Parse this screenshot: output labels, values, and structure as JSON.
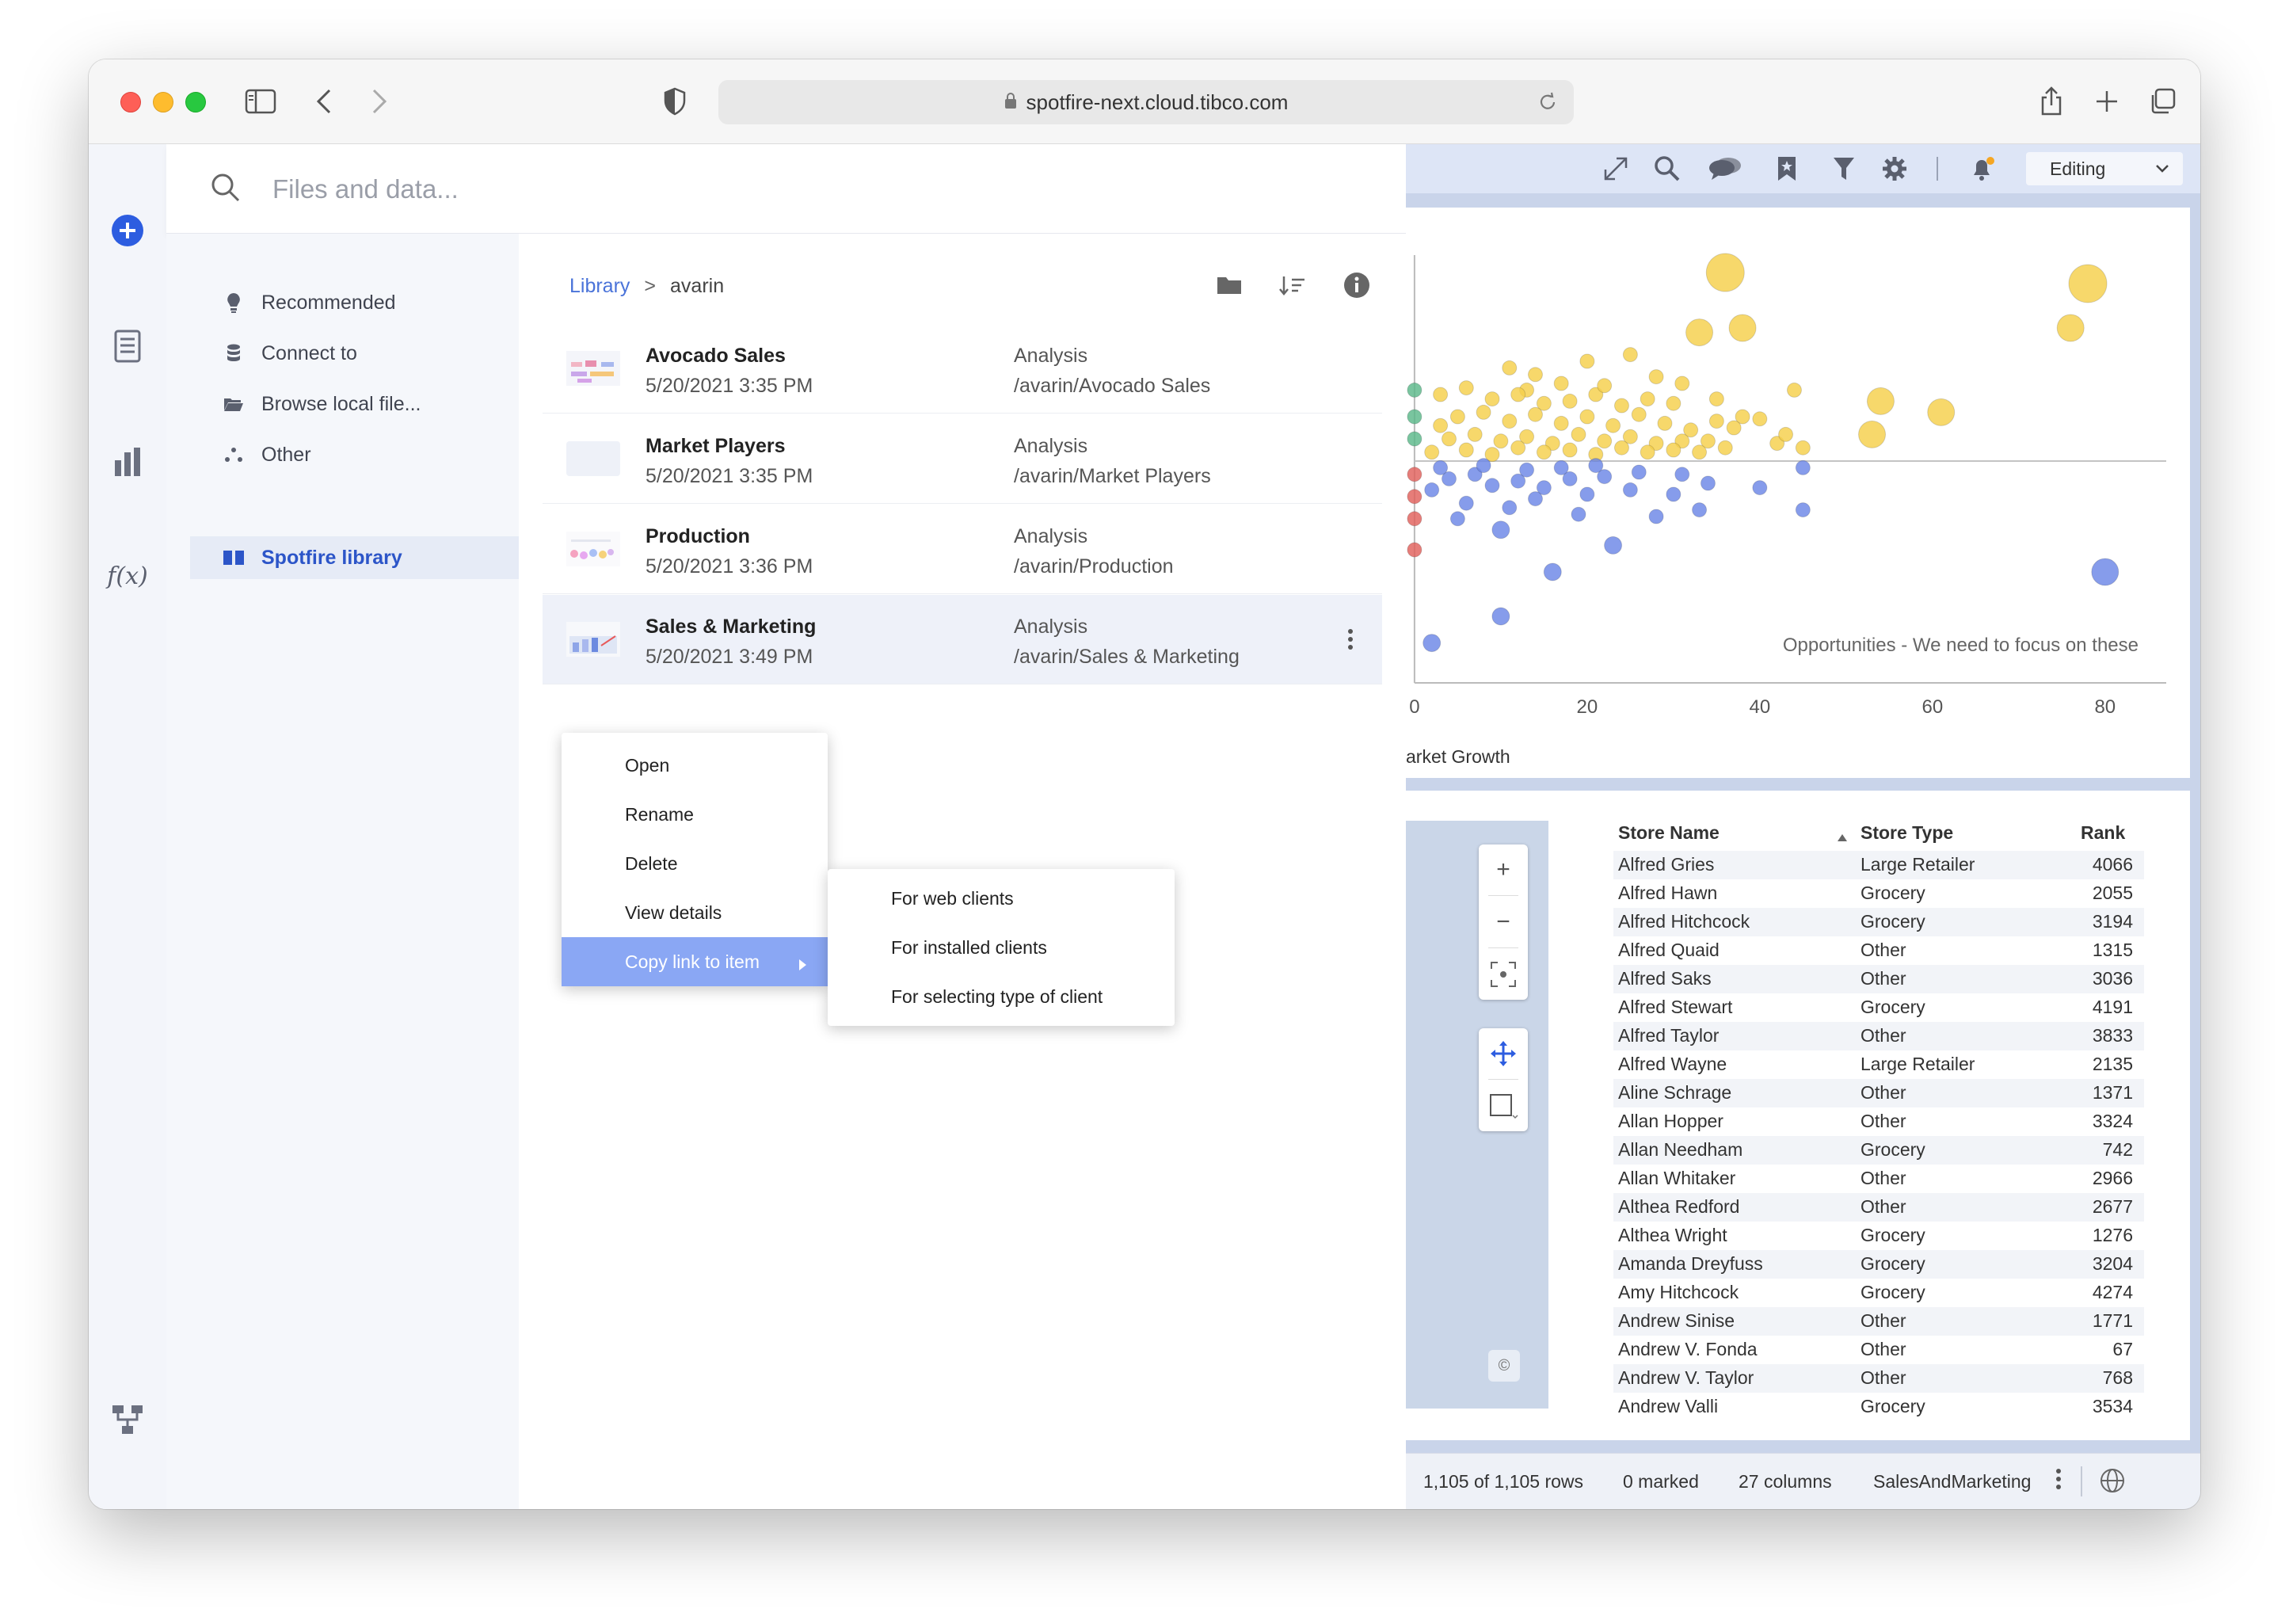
{
  "browser": {
    "url": "spotfire-next.cloud.tibco.com"
  },
  "search": {
    "placeholder": "Files and data..."
  },
  "nav": [
    {
      "label": "Recommended",
      "icon": "lightbulb-icon"
    },
    {
      "label": "Connect to",
      "icon": "database-icon"
    },
    {
      "label": "Browse local file...",
      "icon": "folder-icon"
    },
    {
      "label": "Other",
      "icon": "dots-icon"
    },
    {
      "label": "Spotfire library",
      "icon": "book-icon"
    }
  ],
  "breadcrumb": {
    "root": "Library",
    "separator": ">",
    "current": "avarin"
  },
  "files": [
    {
      "name": "Avocado Sales",
      "date": "5/20/2021 3:35 PM",
      "type": "Analysis",
      "path": "/avarin/Avocado Sales"
    },
    {
      "name": "Market Players",
      "date": "5/20/2021 3:35 PM",
      "type": "Analysis",
      "path": "/avarin/Market Players"
    },
    {
      "name": "Production",
      "date": "5/20/2021 3:36 PM",
      "type": "Analysis",
      "path": "/avarin/Production"
    },
    {
      "name": "Sales & Marketing",
      "date": "5/20/2021 3:49 PM",
      "type": "Analysis",
      "path": "/avarin/Sales & Marketing"
    }
  ],
  "context_menu": [
    "Open",
    "Rename",
    "Delete",
    "View details",
    "Copy link to item"
  ],
  "submenu": [
    "For web clients",
    "For installed clients",
    "For selecting type of client"
  ],
  "analysis": {
    "mode": "Editing",
    "annotation": "Opportunities - We need to focus on these",
    "x_axis_label": "arket Growth"
  },
  "chart_data": {
    "type": "scatter",
    "x_ticks": [
      "0",
      "20",
      "40",
      "60",
      "80"
    ],
    "xlim": [
      -1,
      88
    ],
    "ylim": [
      -10,
      10
    ],
    "reference_y": 0,
    "series": [
      {
        "color": "#f5d04a",
        "points": [
          [
            36,
            8.5
          ],
          [
            78,
            8
          ],
          [
            33,
            5.8
          ],
          [
            38,
            6
          ],
          [
            76,
            6
          ],
          [
            20,
            4.5
          ],
          [
            25,
            4.8
          ],
          [
            11,
            4.2
          ],
          [
            17,
            3.5
          ],
          [
            13,
            3.2
          ],
          [
            28,
            3.8
          ],
          [
            31,
            3.5
          ],
          [
            44,
            3.2
          ],
          [
            54,
            2.7
          ],
          [
            61,
            2.2
          ],
          [
            38,
            2
          ],
          [
            53,
            1.2
          ],
          [
            42,
            0.8
          ],
          [
            45,
            0.6
          ],
          [
            37,
            1.5
          ],
          [
            35,
            1.8
          ],
          [
            40,
            1.9
          ],
          [
            43,
            1.2
          ],
          [
            3,
            3
          ],
          [
            6,
            3.3
          ],
          [
            9,
            2.8
          ],
          [
            12,
            3
          ],
          [
            15,
            2.6
          ],
          [
            18,
            2.7
          ],
          [
            21,
            3
          ],
          [
            24,
            2.5
          ],
          [
            27,
            2.8
          ],
          [
            30,
            2.6
          ],
          [
            5,
            2
          ],
          [
            8,
            2.2
          ],
          [
            11,
            1.8
          ],
          [
            14,
            2.1
          ],
          [
            17,
            1.7
          ],
          [
            20,
            2
          ],
          [
            23,
            1.6
          ],
          [
            26,
            2.1
          ],
          [
            29,
            1.7
          ],
          [
            32,
            1.4
          ],
          [
            4,
            1
          ],
          [
            7,
            1.2
          ],
          [
            10,
            0.9
          ],
          [
            13,
            1.1
          ],
          [
            16,
            0.8
          ],
          [
            19,
            1.2
          ],
          [
            22,
            0.9
          ],
          [
            25,
            1.1
          ],
          [
            28,
            0.8
          ],
          [
            31,
            0.9
          ],
          [
            34,
            0.9
          ],
          [
            2,
            0.4
          ],
          [
            6,
            0.5
          ],
          [
            9,
            0.3
          ],
          [
            12,
            0.6
          ],
          [
            15,
            0.4
          ],
          [
            18,
            0.5
          ],
          [
            21,
            0.3
          ],
          [
            24,
            0.6
          ],
          [
            27,
            0.4
          ],
          [
            30,
            0.5
          ],
          [
            33,
            0.4
          ],
          [
            36,
            0.6
          ],
          [
            3,
            1.6
          ],
          [
            14,
            3.9
          ],
          [
            22,
            3.4
          ],
          [
            35,
            2.8
          ]
        ]
      },
      {
        "color": "#6b86e6",
        "points": [
          [
            80,
            -5
          ],
          [
            45,
            -0.3
          ],
          [
            45,
            -2.2
          ],
          [
            40,
            -1.2
          ],
          [
            34,
            -1
          ],
          [
            33,
            -2.2
          ],
          [
            16,
            -5
          ],
          [
            10,
            -7
          ],
          [
            2,
            -8.2
          ],
          [
            23,
            -3.8
          ],
          [
            28,
            -2.5
          ],
          [
            30,
            -1.5
          ],
          [
            25,
            -1.3
          ],
          [
            20,
            -1.5
          ],
          [
            18,
            -0.8
          ],
          [
            15,
            -1.2
          ],
          [
            12,
            -0.9
          ],
          [
            9,
            -1.1
          ],
          [
            7,
            -0.6
          ],
          [
            4,
            -0.8
          ],
          [
            2,
            -1.3
          ],
          [
            6,
            -1.9
          ],
          [
            11,
            -2.1
          ],
          [
            14,
            -1.7
          ],
          [
            22,
            -0.7
          ],
          [
            26,
            -0.5
          ],
          [
            31,
            -0.6
          ],
          [
            3,
            -0.3
          ],
          [
            8,
            -0.2
          ],
          [
            13,
            -0.4
          ],
          [
            17,
            -0.3
          ],
          [
            21,
            -0.2
          ],
          [
            5,
            -2.6
          ],
          [
            10,
            -3.1
          ],
          [
            19,
            -2.4
          ]
        ]
      },
      {
        "color": "#e0605c",
        "points": [
          [
            0,
            -0.6
          ],
          [
            0,
            -1.6
          ],
          [
            0,
            -2.6
          ],
          [
            0,
            -4
          ]
        ]
      },
      {
        "color": "#5bb88a",
        "points": [
          [
            0,
            1
          ],
          [
            0,
            2
          ],
          [
            0,
            3.2
          ]
        ]
      }
    ]
  },
  "table": {
    "columns": [
      "Store Name",
      "Store Type",
      "Rank"
    ],
    "rows": [
      [
        "Alfred Gries",
        "Large Retailer",
        "4066"
      ],
      [
        "Alfred Hawn",
        "Grocery",
        "2055"
      ],
      [
        "Alfred Hitchcock",
        "Grocery",
        "3194"
      ],
      [
        "Alfred Quaid",
        "Other",
        "1315"
      ],
      [
        "Alfred Saks",
        "Other",
        "3036"
      ],
      [
        "Alfred Stewart",
        "Grocery",
        "4191"
      ],
      [
        "Alfred Taylor",
        "Other",
        "3833"
      ],
      [
        "Alfred Wayne",
        "Large Retailer",
        "2135"
      ],
      [
        "Aline Schrage",
        "Other",
        "1371"
      ],
      [
        "Allan Hopper",
        "Other",
        "3324"
      ],
      [
        "Allan Needham",
        "Grocery",
        "742"
      ],
      [
        "Allan Whitaker",
        "Other",
        "2966"
      ],
      [
        "Althea Redford",
        "Other",
        "2677"
      ],
      [
        "Althea Wright",
        "Grocery",
        "1276"
      ],
      [
        "Amanda Dreyfuss",
        "Grocery",
        "3204"
      ],
      [
        "Amy Hitchcock",
        "Grocery",
        "4274"
      ],
      [
        "Andrew Sinise",
        "Other",
        "1771"
      ],
      [
        "Andrew V. Fonda",
        "Other",
        "67"
      ],
      [
        "Andrew V. Taylor",
        "Other",
        "768"
      ],
      [
        "Andrew Valli",
        "Grocery",
        "3534"
      ]
    ]
  },
  "status": {
    "rows": "1,105 of 1,105 rows",
    "marked": "0 marked",
    "columns": "27 columns",
    "table": "SalesAndMarketing"
  },
  "map": {
    "attribution": "©"
  }
}
